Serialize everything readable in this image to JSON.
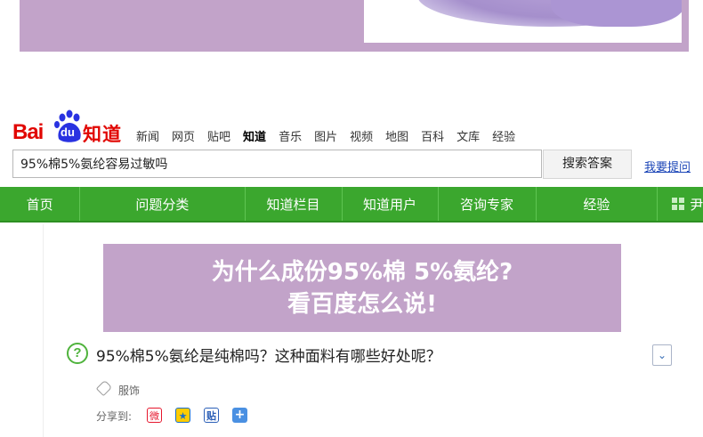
{
  "logo": {
    "bai": "Bai",
    "du": "du",
    "zhidao": "知道"
  },
  "toplinks": [
    "新闻",
    "网页",
    "贴吧",
    "知道",
    "音乐",
    "图片",
    "视频",
    "地图",
    "百科",
    "文库",
    "经验"
  ],
  "toplinks_active": "知道",
  "search": {
    "value": "95%棉5%氨纶容易过敏吗",
    "button": "搜索答案",
    "ask_link": "我要提问"
  },
  "menu": [
    "首页",
    "问题分类",
    "知道栏目",
    "知道用户",
    "咨询专家",
    "经验"
  ],
  "menu_more": "尹",
  "promo": {
    "line1": "为什么成份95%棉 5%氨纶?",
    "line2": "看百度怎么说!"
  },
  "question": {
    "icon": "?",
    "title": "95%棉5%氨纶是纯棉吗？这种面料有哪些好处呢？"
  },
  "tag": "服饰",
  "share": {
    "label": "分享到:",
    "icons": [
      "weibo-icon",
      "qzone-icon",
      "tieba-icon",
      "more-share-icon"
    ]
  },
  "colors": {
    "brand_red": "#e10602",
    "menu_green": "#3ba72e",
    "promo_purple": "#c2a3c9",
    "link_blue": "#1b45b7"
  }
}
